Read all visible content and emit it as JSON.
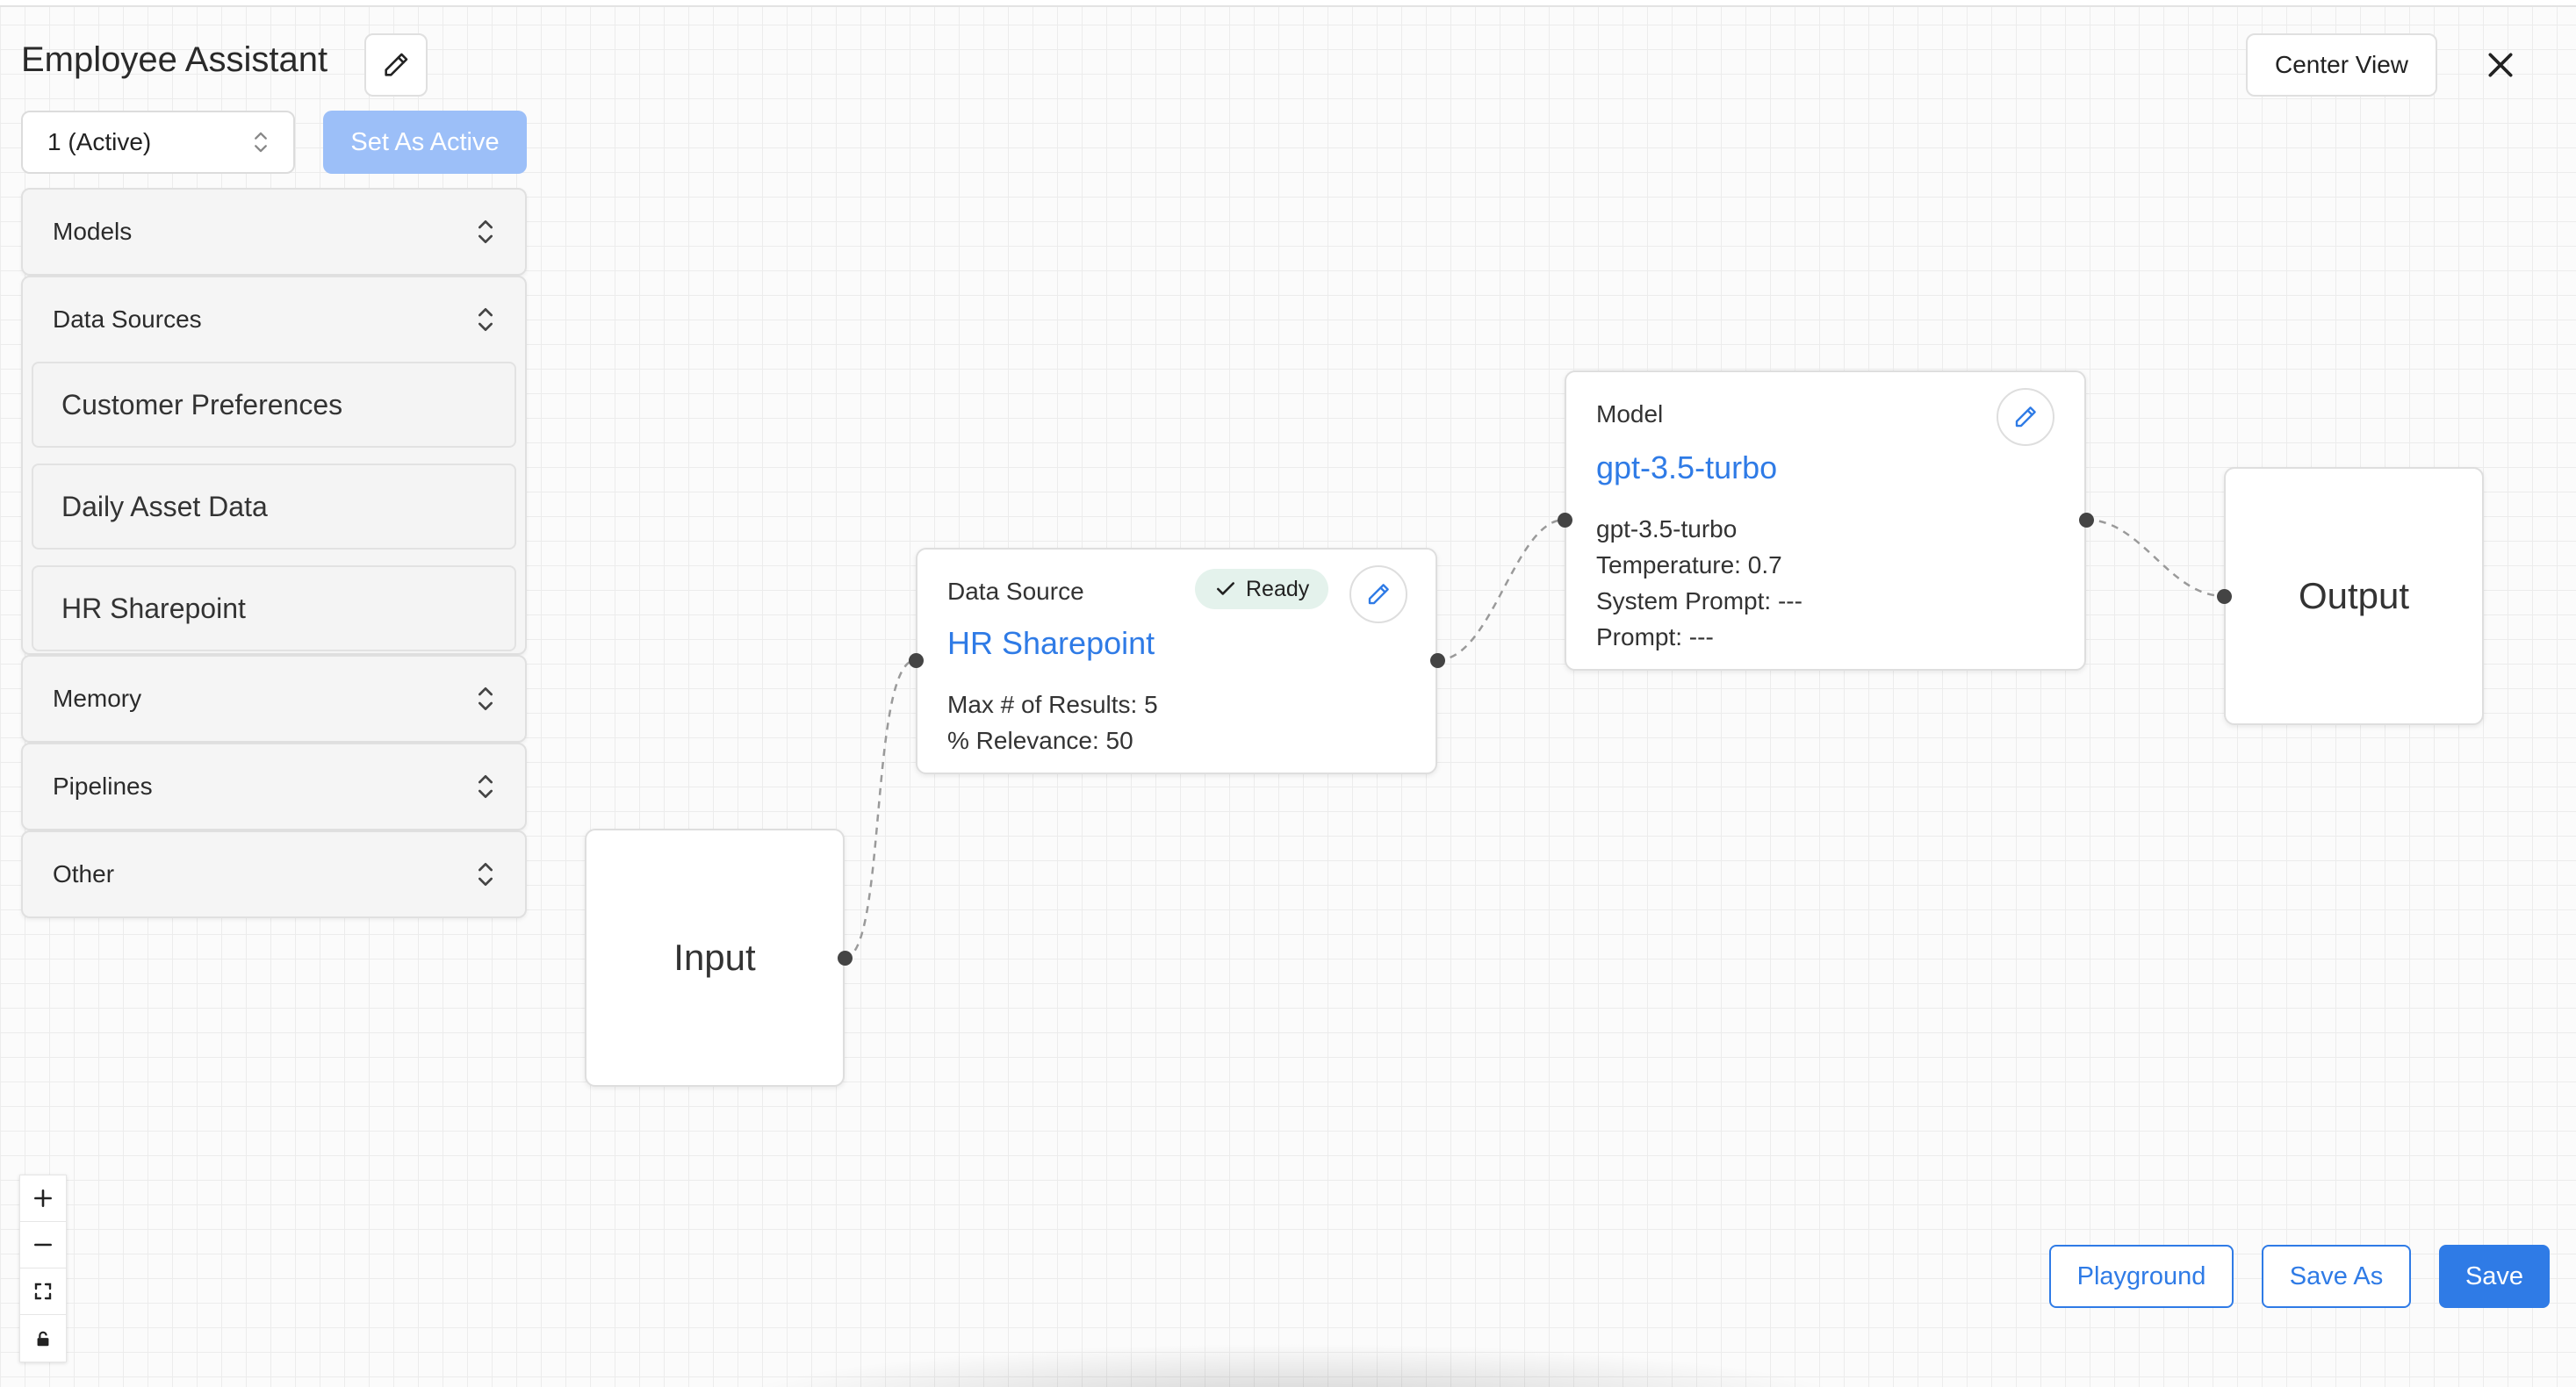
{
  "header": {
    "title": "Employee Assistant",
    "center_view_label": "Center View"
  },
  "version": {
    "selected": "1 (Active)",
    "set_active_label": "Set As Active"
  },
  "sidebar": {
    "sections": [
      {
        "label": "Models"
      },
      {
        "label": "Data Sources",
        "items": [
          "Customer Preferences",
          "Daily Asset Data",
          "HR Sharepoint"
        ]
      },
      {
        "label": "Memory"
      },
      {
        "label": "Pipelines"
      },
      {
        "label": "Other"
      }
    ]
  },
  "canvas": {
    "input_node": {
      "label": "Input"
    },
    "output_node": {
      "label": "Output"
    },
    "data_source_node": {
      "type": "Data Source",
      "status": "Ready",
      "title": "HR Sharepoint",
      "lines": [
        "Max # of Results: 5",
        "% Relevance: 50"
      ]
    },
    "model_node": {
      "type": "Model",
      "title": "gpt-3.5-turbo",
      "lines": [
        "gpt-3.5-turbo",
        "Temperature: 0.7",
        "System Prompt: ---",
        "Prompt: ---"
      ]
    }
  },
  "footer": {
    "playground_label": "Playground",
    "save_as_label": "Save As",
    "save_label": "Save"
  },
  "colors": {
    "accent": "#2f7be6",
    "accent_disabled": "#9cbff8",
    "ready_badge_bg": "#e4f2ec"
  },
  "icons": [
    "pencil-icon",
    "close-icon",
    "chevron-updown-icon",
    "check-icon",
    "plus-icon",
    "minus-icon",
    "fit-view-icon",
    "lock-icon"
  ]
}
